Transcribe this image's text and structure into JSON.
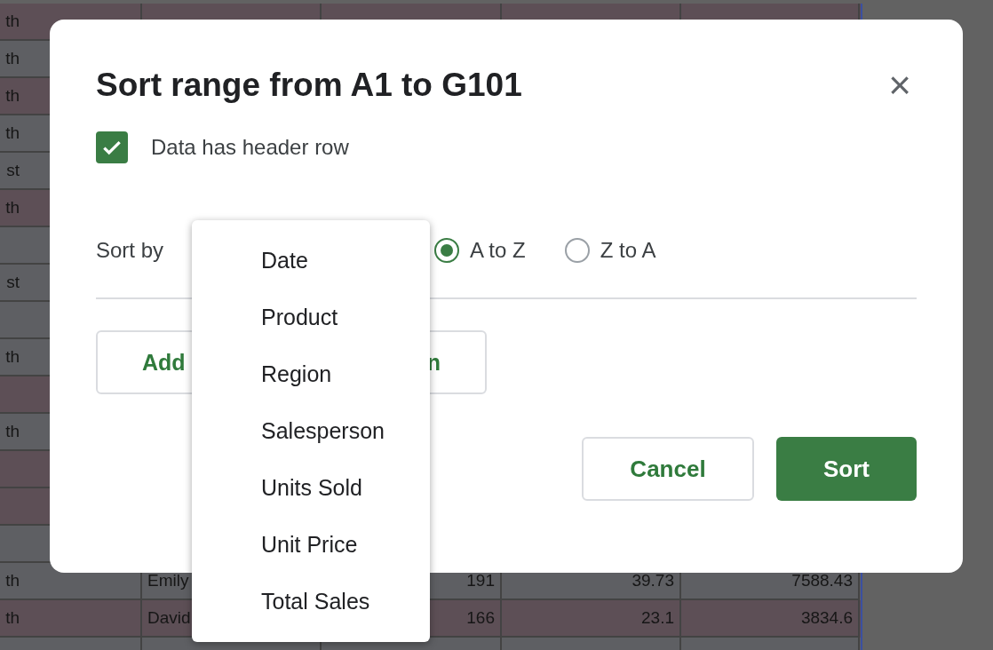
{
  "sheet": {
    "rows": [
      {
        "color": "#5d4f56",
        "cells": [
          "th"
        ]
      },
      {
        "color": "#5e5f63",
        "cells": [
          "th"
        ]
      },
      {
        "color": "#5d4f56",
        "cells": [
          "th"
        ]
      },
      {
        "color": "#5e5f63",
        "cells": [
          "th"
        ]
      },
      {
        "color": "#5e5f63",
        "cells": [
          "st"
        ]
      },
      {
        "color": "#5d4f56",
        "cells": [
          "th"
        ]
      },
      {
        "color": "#5e5f63",
        "cells": []
      },
      {
        "color": "#5e5f63",
        "cells": [
          "st"
        ]
      },
      {
        "color": "#5e5f63",
        "cells": []
      },
      {
        "color": "#5e5f63",
        "cells": [
          "th"
        ]
      },
      {
        "color": "#5d4f56",
        "cells": []
      },
      {
        "color": "#5e5f63",
        "cells": [
          "th"
        ]
      },
      {
        "color": "#5d4f56",
        "cells": []
      },
      {
        "color": "#5d4f56",
        "cells": []
      },
      {
        "color": "#5e5f63",
        "cells": []
      },
      {
        "color": "#5e5f63",
        "cells": [
          "th",
          "Emily",
          "191",
          "39.73",
          "7588.43"
        ]
      },
      {
        "color": "#5d4f56",
        "cells": [
          "th",
          "David",
          "166",
          "23.1",
          "3834.6"
        ]
      },
      {
        "color": "#5e5f63",
        "cells": []
      }
    ]
  },
  "dialog": {
    "title": "Sort range from A1 to G101",
    "close": "×",
    "header_row": {
      "label": "Data has header row",
      "checked": true
    },
    "sort_by": {
      "label": "Sort by",
      "options": [
        {
          "label": "A to Z",
          "selected": true
        },
        {
          "label": "Z to A",
          "selected": false
        }
      ]
    },
    "add_button": {
      "label_start": "Add",
      "label_end": "n"
    },
    "buttons": [
      {
        "kind": "secondary",
        "label": "Cancel"
      },
      {
        "kind": "primary",
        "label": "Sort"
      }
    ]
  },
  "menu": {
    "items": [
      "Date",
      "Product",
      "Region",
      "Salesperson",
      "Units Sold",
      "Unit Price",
      "Total Sales"
    ]
  }
}
